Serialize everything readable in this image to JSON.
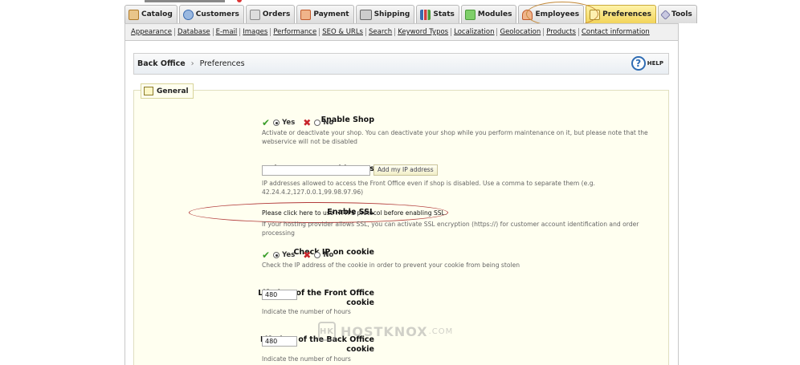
{
  "tabs": [
    {
      "label": "Catalog",
      "icon": "catalog-icon",
      "color": "#b07a2a"
    },
    {
      "label": "Customers",
      "icon": "customers-icon",
      "color": "#3a6bb0"
    },
    {
      "label": "Orders",
      "icon": "orders-icon",
      "color": "#888888"
    },
    {
      "label": "Payment",
      "icon": "payment-icon",
      "color": "#c25a2a"
    },
    {
      "label": "Shipping",
      "icon": "shipping-icon",
      "color": "#666666"
    },
    {
      "label": "Stats",
      "icon": "stats-icon",
      "color": "#3a6bb0"
    },
    {
      "label": "Modules",
      "icon": "modules-icon",
      "color": "#4a9a3a"
    },
    {
      "label": "Employees",
      "icon": "employees-icon",
      "color": "#c25a2a"
    },
    {
      "label": "Preferences",
      "icon": "preferences-icon",
      "color": "#d9a82a"
    },
    {
      "label": "Tools",
      "icon": "tools-icon",
      "color": "#7a7aa8"
    }
  ],
  "subnav": [
    "Appearance",
    "Database",
    "E-mail",
    "Images",
    "Performance",
    "SEO & URLs",
    "Search",
    "Keyword Typos",
    "Localization",
    "Geolocation",
    "Products",
    "Contact information"
  ],
  "breadcrumb": {
    "root": "Back Office",
    "sep": "›",
    "current": "Preferences",
    "help": "HELP"
  },
  "section": {
    "title": "General"
  },
  "fields": {
    "enable_shop": {
      "label": "Enable Shop",
      "yes": "Yes",
      "no": "No",
      "desc": "Activate or deactivate your shop. You can deactivate your shop while you perform maintenance on it, but please note that the webservice will not be disabled"
    },
    "maintenance_ip": {
      "label": "Maintenance IP addresses",
      "value": "",
      "button": "Add my IP address",
      "desc": "IP addresses allowed to access the Front Office even if shop is disabled. Use a comma to separate them (e.g. 42.24.4.2,127.0.0.1,99.98.97.96)"
    },
    "enable_ssl": {
      "label": "Enable SSL",
      "text": "Please click here to use HTTPS protocol before enabling SSL.",
      "desc": "If your hosting provider allows SSL, you can activate SSL encryption (https://) for customer account identification and order processing"
    },
    "check_ip_cookie": {
      "label": "Check IP on cookie",
      "yes": "Yes",
      "no": "No",
      "desc": "Check the IP address of the cookie in order to prevent your cookie from being stolen"
    },
    "front_cookie": {
      "label_1": "Lifetime of the Front Office",
      "label_2": "cookie",
      "value": "480",
      "desc": "Indicate the number of hours"
    },
    "back_cookie": {
      "label_1": "Lifetime of the Back Office",
      "label_2": "cookie",
      "value": "480",
      "desc": "Indicate the number of hours"
    }
  },
  "watermark": {
    "mark": "HK",
    "text": "HOSTKNOX",
    "suffix": ".COM"
  }
}
